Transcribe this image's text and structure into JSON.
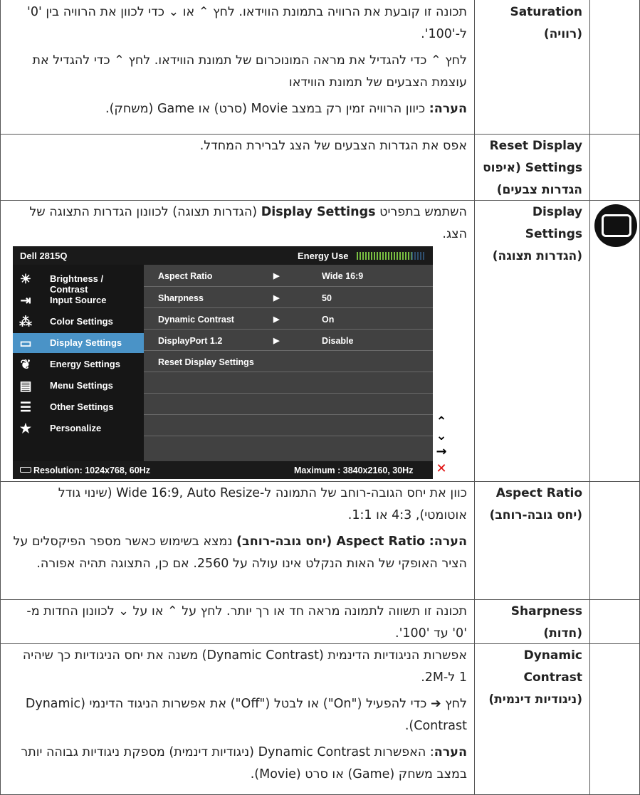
{
  "rows": [
    {
      "setting_en": "Saturation",
      "setting_he": "(רוויה)",
      "paragraphs": [
        "תכונה זו קובעת את הרוויה בתמונת הווידאו. לחץ ⌃ או ⌄ כדי לכוון את הרוויה בין '0' ל-'100'.",
        "לחץ ⌃ כדי להגדיל את מראה המונוכרום של תמונת הווידאו. לחץ ⌃ כדי להגדיל את עוצמת הצבעים של תמונת הווידאו"
      ],
      "note_label": "הערה:",
      "note_text": "כיוון הרוויה זמין רק במצב Movie (סרט) או Game (משחק)."
    },
    {
      "setting_en": "Reset Display",
      "setting_he": "Settings (איפוס הגדרות צבעים)",
      "paragraphs": [
        "אפס את הגדרות הצבעים של הצג לברירת המחדל."
      ]
    },
    {
      "setting_en": "Display Settings",
      "setting_he": "(הגדרות תצוגה)",
      "intro_pre": "השתמש בתפריט",
      "intro_bold": "Display Settings",
      "intro_post": "(הגדרות תצוגה) לכוונון הגדרות התצוגה של הצג.",
      "icon": "display-settings-monitor-icon"
    },
    {
      "setting_en": "Aspect Ratio",
      "setting_he": "(יחס גובה-רוחב)",
      "paragraphs": [
        "כוון את יחס הגובה-רוחב של התמונה ל-Wide 16:9, Auto Resize (שינוי גודל אוטומטי), 4:3 או 1:1."
      ],
      "note_label": "הערה:",
      "note_bold": "Aspect Ratio (יחס גובה-רוחב)",
      "note_text": "נמצא בשימוש כאשר מספר הפיקסלים על הציר האופקי של האות הנקלט אינו עולה על 2560. אם כן, התצוגה תהיה אפורה."
    },
    {
      "setting_en": "Sharpness",
      "setting_he": "(חדות)",
      "paragraphs": [
        "תכונה זו תשווה לתמונה מראה חד או רך יותר. לחץ על ⌃ או על ⌄ לכוונון החדות מ-'0' עד '100'."
      ]
    },
    {
      "setting_en": "Dynamic",
      "setting_he": "Contrast (ניגודיות דינמית)",
      "paragraphs": [
        "אפשרות הניגודיות הדינמית (Dynamic Contrast) משנה את יחס הניגודיות כך שיהיה 1 ל-2M.",
        "לחץ ➔ כדי להפעיל (\"On\") או לבטל (\"Off\") את אפשרות הניגוד הדינמי (Dynamic Contrast)."
      ],
      "note_label": "הערה",
      "note_text": ": האפשרות Dynamic Contrast (ניגודיות דינמית) מספקת ניגודיות גבוהה יותר במצב משחק (Game) או סרט (Movie)."
    }
  ],
  "osd": {
    "model": "Dell 2815Q",
    "energy_label": "Energy Use",
    "energy_level": 0.8,
    "menu": [
      {
        "label": "Brightness / Contrast",
        "icon": "sun-icon"
      },
      {
        "label": "Input Source",
        "icon": "input-source-icon"
      },
      {
        "label": "Color Settings",
        "icon": "color-dots-icon"
      },
      {
        "label": "Display Settings",
        "icon": "monitor-icon",
        "selected": true
      },
      {
        "label": "Energy Settings",
        "icon": "leaf-icon"
      },
      {
        "label": "Menu Settings",
        "icon": "menu-doc-icon"
      },
      {
        "label": "Other Settings",
        "icon": "sliders-icon"
      },
      {
        "label": "Personalize",
        "icon": "star-icon"
      }
    ],
    "options": [
      {
        "label": "Aspect Ratio",
        "value": "Wide 16:9",
        "arrow": "▶"
      },
      {
        "label": "Sharpness",
        "value": "50",
        "arrow": "▶"
      },
      {
        "label": "Dynamic Contrast",
        "value": "On",
        "arrow": "▶"
      },
      {
        "label": "DisplayPort 1.2",
        "value": "Disable",
        "arrow": "▶"
      },
      {
        "label": "Reset Display Settings",
        "value": "",
        "arrow": ""
      }
    ],
    "resolution": "Resolution: 1024x768,  60Hz",
    "maximum": "Maximum : 3840x2160,  30Hz",
    "nav": {
      "up": "⌃",
      "down": "⌄",
      "enter": "→",
      "exit": "✕"
    },
    "colors": {
      "selected": "#4a93c7",
      "exit": "#e01010",
      "energy_on": "#7ac142"
    }
  }
}
